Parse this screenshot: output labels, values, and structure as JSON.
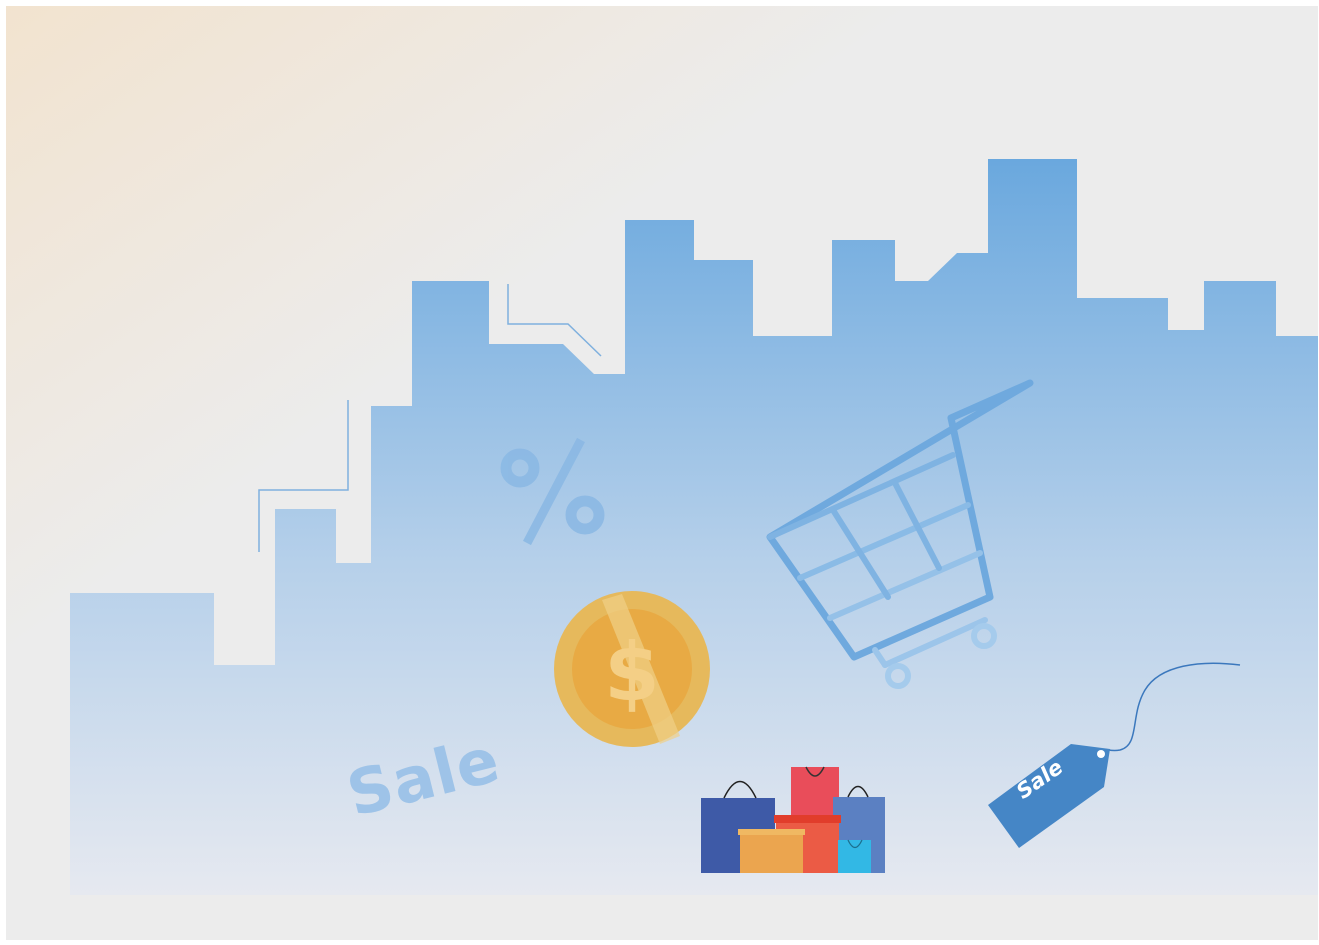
{
  "illustration": {
    "sale_text": "Sale",
    "tag_text": "Sale",
    "percent_symbol": "%",
    "coin_symbol": "$"
  },
  "colors": {
    "skyline_top": "#74ade0",
    "skyline_bottom": "#dbe6f2",
    "coin_gold": "#e8b85a",
    "coin_dark": "#e9a23a",
    "cart_blue": "#7ab1e2",
    "tag_blue": "#4586c6",
    "bag_navy": "#3e5aa7",
    "bag_red": "#e94d5a",
    "bag_orange": "#eb5b45",
    "bag_yellow": "#eba54f",
    "bag_blue": "#5b80c2",
    "bag_cyan": "#32b8e5"
  }
}
